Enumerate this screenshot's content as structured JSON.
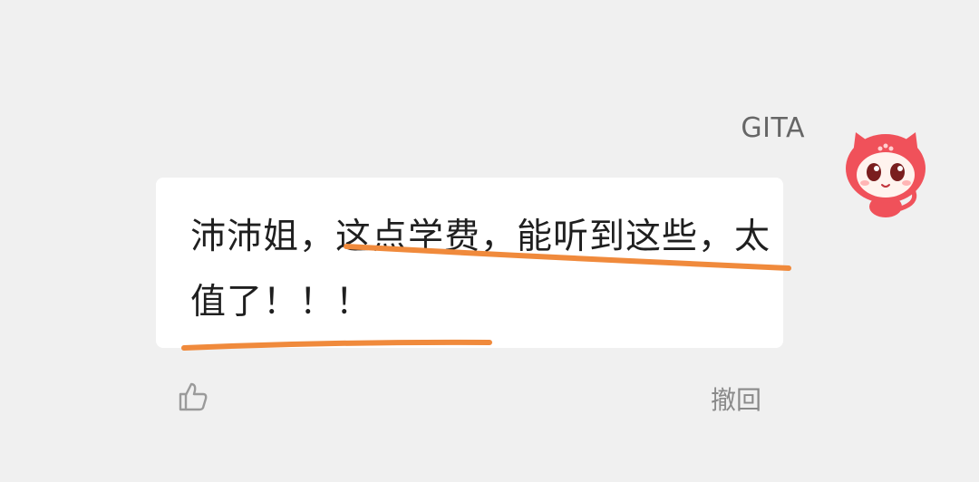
{
  "comment": {
    "username": "GITA",
    "message": "沛沛姐，这点学费，能听到这些，太值了！！！",
    "recall_label": "撤回"
  },
  "icons": {
    "avatar": "red-cat-mascot-avatar",
    "like": "thumbs-up-icon"
  },
  "colors": {
    "background": "#f0f0f0",
    "bubble": "#ffffff",
    "highlight": "#f08a3c",
    "avatar_red": "#f0515a"
  }
}
